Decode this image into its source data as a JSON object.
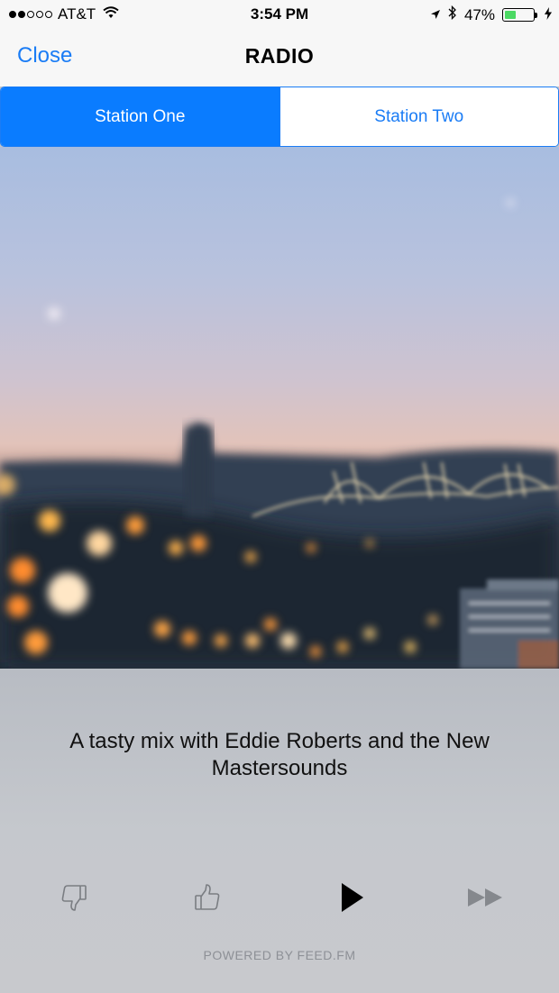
{
  "status_bar": {
    "carrier": "AT&T",
    "signal_bars_filled": 2,
    "signal_bars_total": 5,
    "time": "3:54 PM",
    "battery_percent": "47%",
    "battery_level": 0.47
  },
  "nav": {
    "close_label": "Close",
    "title": "RADIO"
  },
  "stations": {
    "tabs": [
      {
        "label": "Station One",
        "selected": true
      },
      {
        "label": "Station Two",
        "selected": false
      }
    ]
  },
  "now_playing": {
    "title": "A tasty mix with Eddie Roberts and the New Mastersounds"
  },
  "controls": {
    "dislike_icon": "thumbs-down-icon",
    "like_icon": "thumbs-up-icon",
    "play_icon": "play-icon",
    "skip_icon": "skip-forward-icon"
  },
  "footer": {
    "powered_by": "POWERED BY FEED.FM"
  },
  "colors": {
    "accent": "#1a7cf5",
    "selected_tab": "#0a7cff"
  }
}
